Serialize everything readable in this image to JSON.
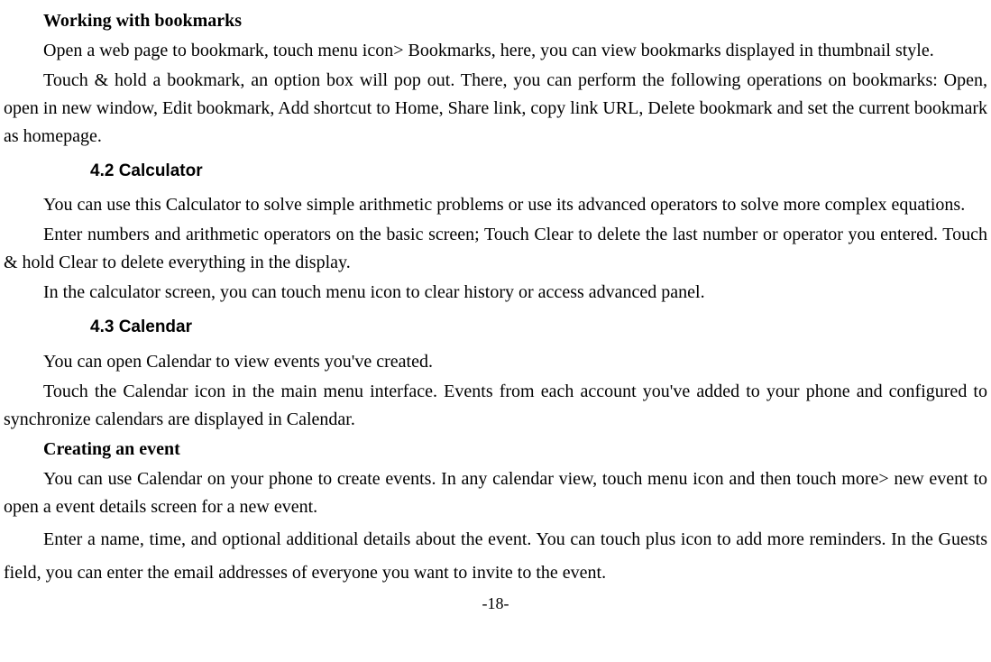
{
  "bookmarks": {
    "heading": "Working with bookmarks",
    "p1": "Open a web page to bookmark, touch menu icon> Bookmarks, here, you can view bookmarks displayed in thumbnail style.",
    "p2": "Touch & hold a bookmark, an option box will pop out. There, you can perform the following operations on bookmarks: Open, open in new window, Edit bookmark, Add shortcut to Home, Share link, copy link URL, Delete bookmark and set the current bookmark as homepage."
  },
  "section42": {
    "heading": "4.2    Calculator",
    "p1": "You can use this Calculator to solve simple arithmetic problems or use its advanced operators to solve more complex equations.",
    "p2": "Enter numbers and arithmetic operators on the basic screen; Touch Clear to delete the last number or operator you entered. Touch & hold Clear to delete everything in the display.",
    "p3": "In the calculator screen, you can touch menu icon to clear history or access advanced panel."
  },
  "section43": {
    "heading": "4.3    Calendar",
    "p1": "You can open Calendar to view events you've created.",
    "p2": "Touch the Calendar icon in the main menu interface. Events from each account you've added to your phone and configured to synchronize calendars are displayed in Calendar.",
    "subheading": "Creating an event",
    "p3": "You can use Calendar on your phone to create events. In any calendar view, touch menu icon and then touch more> new event to open a event details screen for a new event.",
    "p4": "Enter a name, time, and optional additional details about the event. You can touch plus icon to add more reminders. In the Guests field, you can enter the email addresses of everyone you want to invite to the event."
  },
  "pageNumber": "-18-"
}
